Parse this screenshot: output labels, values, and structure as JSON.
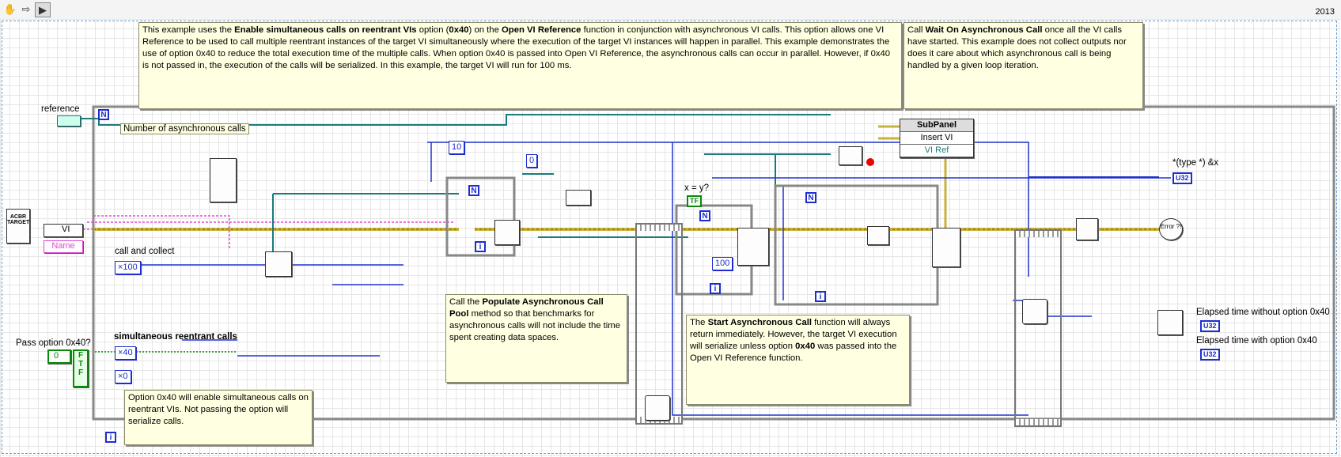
{
  "version_label": "2013",
  "toolbar": {
    "hand_icon": "✋",
    "arrow_icon": "⇨",
    "run_icon": "▶"
  },
  "notes": {
    "intro": {
      "p1": "This example uses the ",
      "b1": "Enable simultaneous calls on reentrant VIs",
      "p2": " option (",
      "b2": "0x40",
      "p3": ") on the ",
      "b3": "Open VI Reference",
      "p4": " function in conjunction with asynchronous VI calls. This option allows one VI Reference to be used to call multiple reentrant instances of the target VI simultaneously where the execution of the target VI instances will happen in parallel. This example demonstrates the use of option 0x40 to reduce the total execution time of the multiple calls. When option 0x40 is passed into Open VI Reference, the asynchronous calls can occur in parallel. However, if 0x40 is not passed in, the execution of the calls will be serialized. In this example, the target VI will run for 100 ms."
    },
    "wait": {
      "p1": "Call ",
      "b1": "Wait On Asynchronous Call",
      "p2": " once all the VI calls have started. This example does not collect outputs nor does it care about which asynchronous call is being handled by a given loop iteration."
    },
    "populate": {
      "p1": "Call the ",
      "b1": "Populate Asynchronous Call Pool",
      "p2": " method so that benchmarks for asynchronous calls will not include the time spent creating data spaces."
    },
    "start": {
      "p1": "The ",
      "b1": "Start Asynchronous Call",
      "p2": " function will always return immediately. However, the target VI execution will serialize unless option ",
      "b2": "0x40",
      "p3": " was passed into the Open VI Reference function."
    },
    "option": "Option 0x40 will enable simultaneous calls on reentrant VIs. Not passing the option will serialize calls."
  },
  "labels": {
    "reference": "reference",
    "num_calls": "Number of asynchronous calls",
    "call_collect": "call and collect",
    "simultaneous": "simultaneous reentrant calls",
    "pass_option": "Pass option 0x40?",
    "x_eq_y": "x = y?",
    "type_x": "*(type *) &x",
    "elapsed_without": "Elapsed time without option 0x40",
    "elapsed_with": "Elapsed time with option 0x40",
    "vi_name": "Name",
    "vi_ctrl": "VI",
    "acbr": "ACBR TARGET",
    "error": "Error ?!"
  },
  "constants": {
    "c10": "10",
    "c0": "0",
    "c100_call": "×100",
    "c40": "×40",
    "c0hex": "×0",
    "c100_ms": "100",
    "bool_ctrl": "0"
  },
  "indicators": {
    "tf": "TF",
    "u32": "U32"
  },
  "subpanel": {
    "title": "SubPanel",
    "method": "Insert VI",
    "prop": "VI Ref"
  },
  "loop_tags": {
    "n": "N",
    "i": "i"
  },
  "bool_values": [
    "F",
    "T",
    "F"
  ]
}
